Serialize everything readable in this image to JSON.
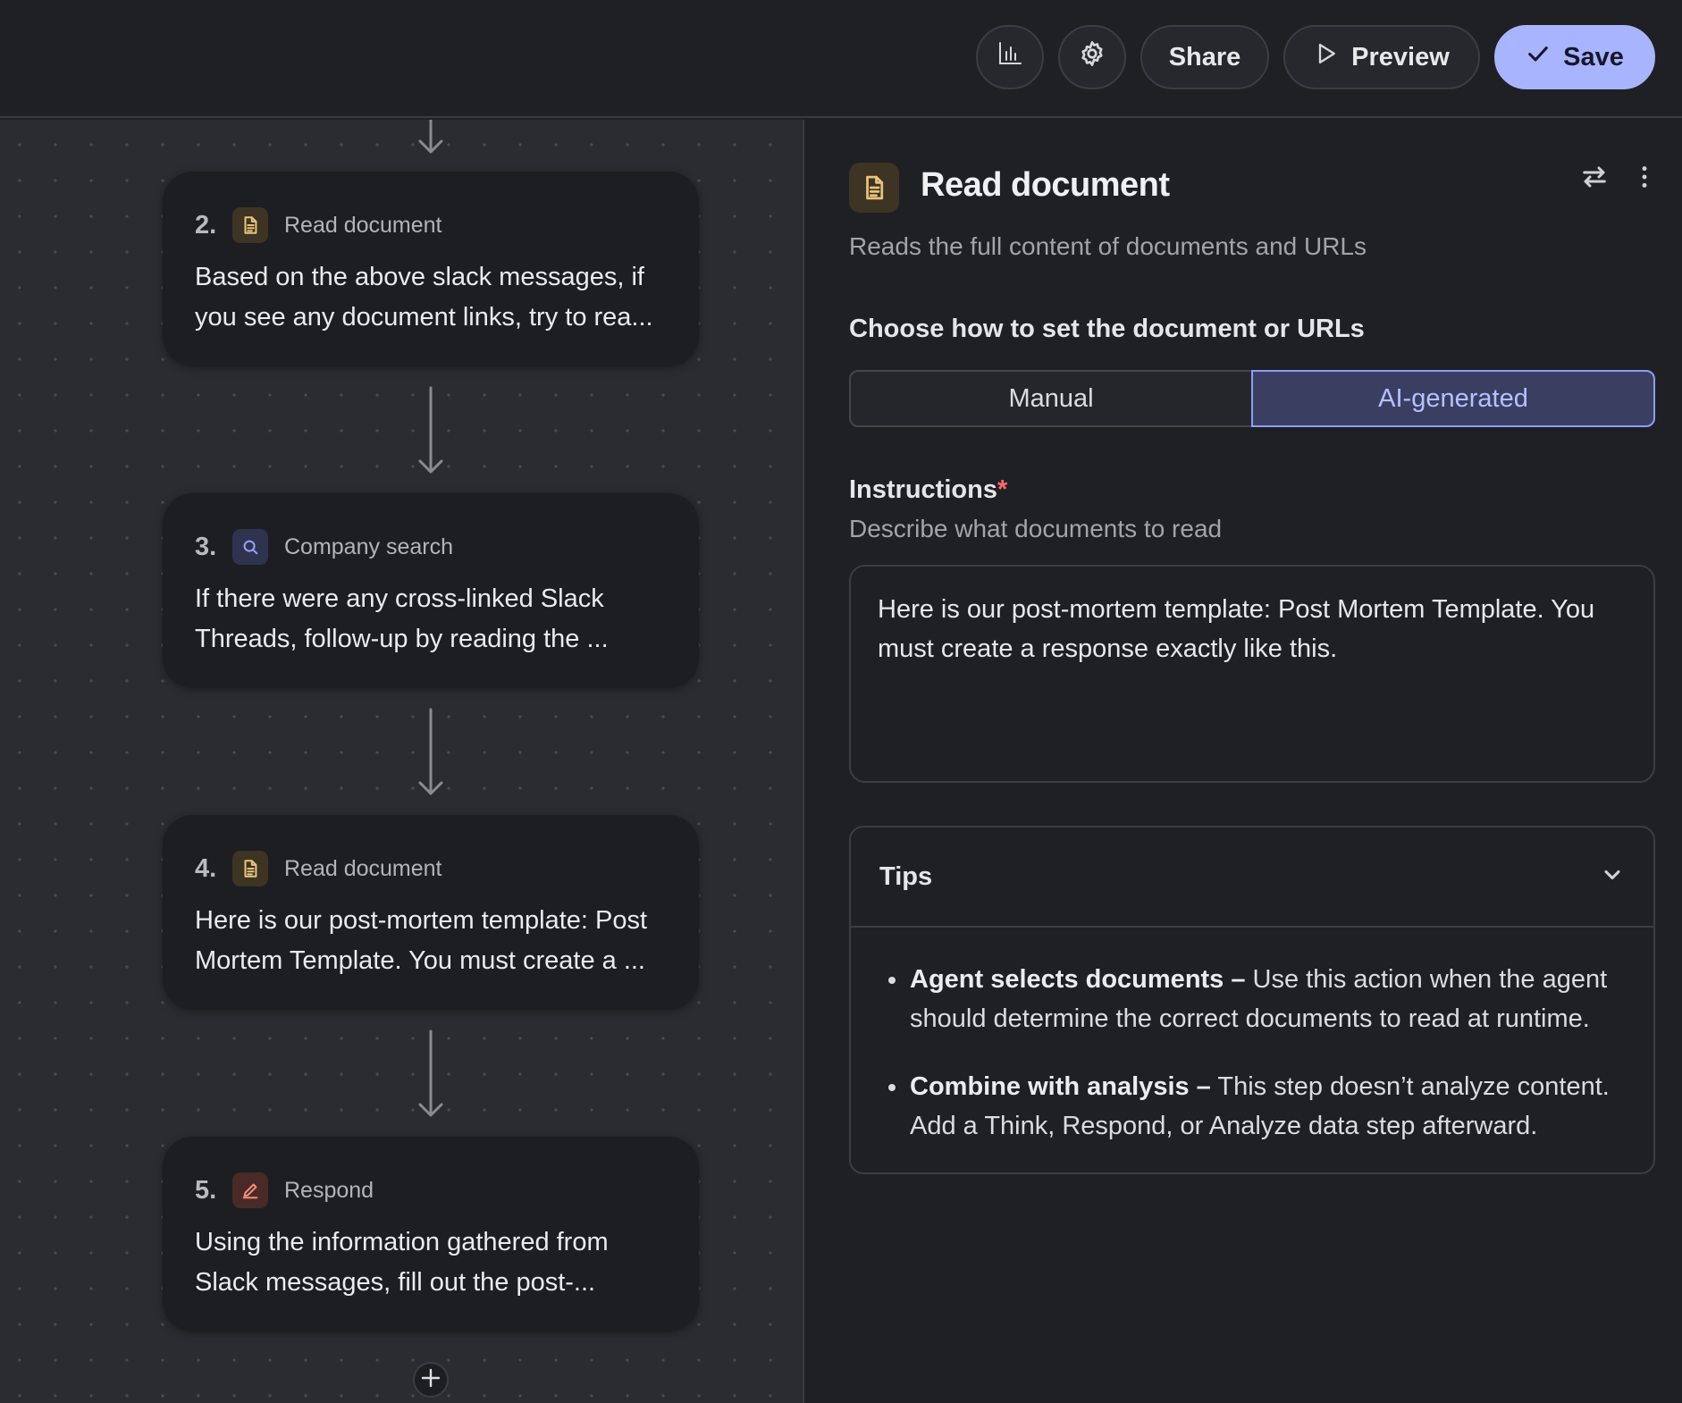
{
  "toolbar": {
    "share_label": "Share",
    "preview_label": "Preview",
    "save_label": "Save",
    "analytics_icon": "bar-chart-icon",
    "settings_icon": "gear-icon",
    "accent_color": "#a9b4ff"
  },
  "workflow": {
    "steps": [
      {
        "number": "2.",
        "type": "Read document",
        "icon": "document-icon",
        "text": "Based on the above slack messages, if you see any document links, try to rea..."
      },
      {
        "number": "3.",
        "type": "Company search",
        "icon": "search-icon",
        "text": "If there were any cross-linked Slack Threads, follow-up by reading the ..."
      },
      {
        "number": "4.",
        "type": "Read document",
        "icon": "document-icon",
        "text": "Here is our post-mortem template: Post Mortem Template. You must create a ..."
      },
      {
        "number": "5.",
        "type": "Respond",
        "icon": "pen-icon",
        "text": "Using the information gathered from Slack messages, fill out the post-..."
      }
    ],
    "add_icon": "plus-icon"
  },
  "panel": {
    "title": "Read document",
    "description": "Reads the full content of documents and URLs",
    "choose_label": "Choose how to set the document or URLs",
    "mode_options": [
      "Manual",
      "AI-generated"
    ],
    "selected_mode": "AI-generated",
    "instructions_label": "Instructions",
    "required_marker": "*",
    "instructions_hint": "Describe what documents to read",
    "instructions_value": "Here is our post-mortem template: Post Mortem Template. You must create a response exactly like this.",
    "tips": {
      "title": "Tips",
      "items": [
        {
          "bold": "Agent selects documents –",
          "text": " Use this action when the agent should determine the correct documents to read at runtime."
        },
        {
          "bold": "Combine with analysis –",
          "text": " This step doesn’t analyze content. Add a Think, Respond, or Analyze data step afterward."
        }
      ]
    }
  }
}
